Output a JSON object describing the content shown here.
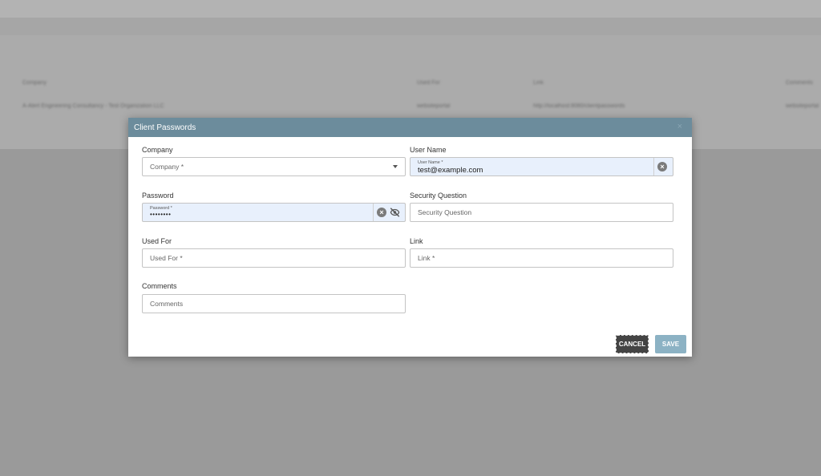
{
  "background": {
    "table_headers": [
      "Company",
      "Used For",
      "Link",
      "Comments"
    ],
    "row": [
      "A-Alert Engineering Consultancy - Test Organization LLC",
      "websiteportal",
      "http://localhost:8080/clientpasswords",
      "websiteportal"
    ]
  },
  "modal": {
    "title": "Client Passwords",
    "close_glyph": "×",
    "fields": {
      "company": {
        "label": "Company",
        "placeholder": "Company *"
      },
      "username": {
        "label": "User Name",
        "floating_label": "User Name *",
        "value": "test@example.com"
      },
      "password": {
        "label": "Password",
        "floating_label": "Password *",
        "value": "••••••••"
      },
      "security_question": {
        "label": "Security Question",
        "placeholder": "Security Question"
      },
      "used_for": {
        "label": "Used For",
        "placeholder": "Used For *"
      },
      "link": {
        "label": "Link",
        "placeholder": "Link *"
      },
      "comments": {
        "label": "Comments",
        "placeholder": "Comments"
      }
    },
    "buttons": {
      "cancel": "CANCEL",
      "save": "SAVE"
    },
    "colors": {
      "header": "#6c8c9c",
      "save": "#8cb2c4",
      "cancel": "#444444",
      "filled": "#e8f0fc"
    },
    "icons": [
      "dropdown-caret-icon",
      "clear-icon",
      "visibility-off-icon"
    ]
  }
}
